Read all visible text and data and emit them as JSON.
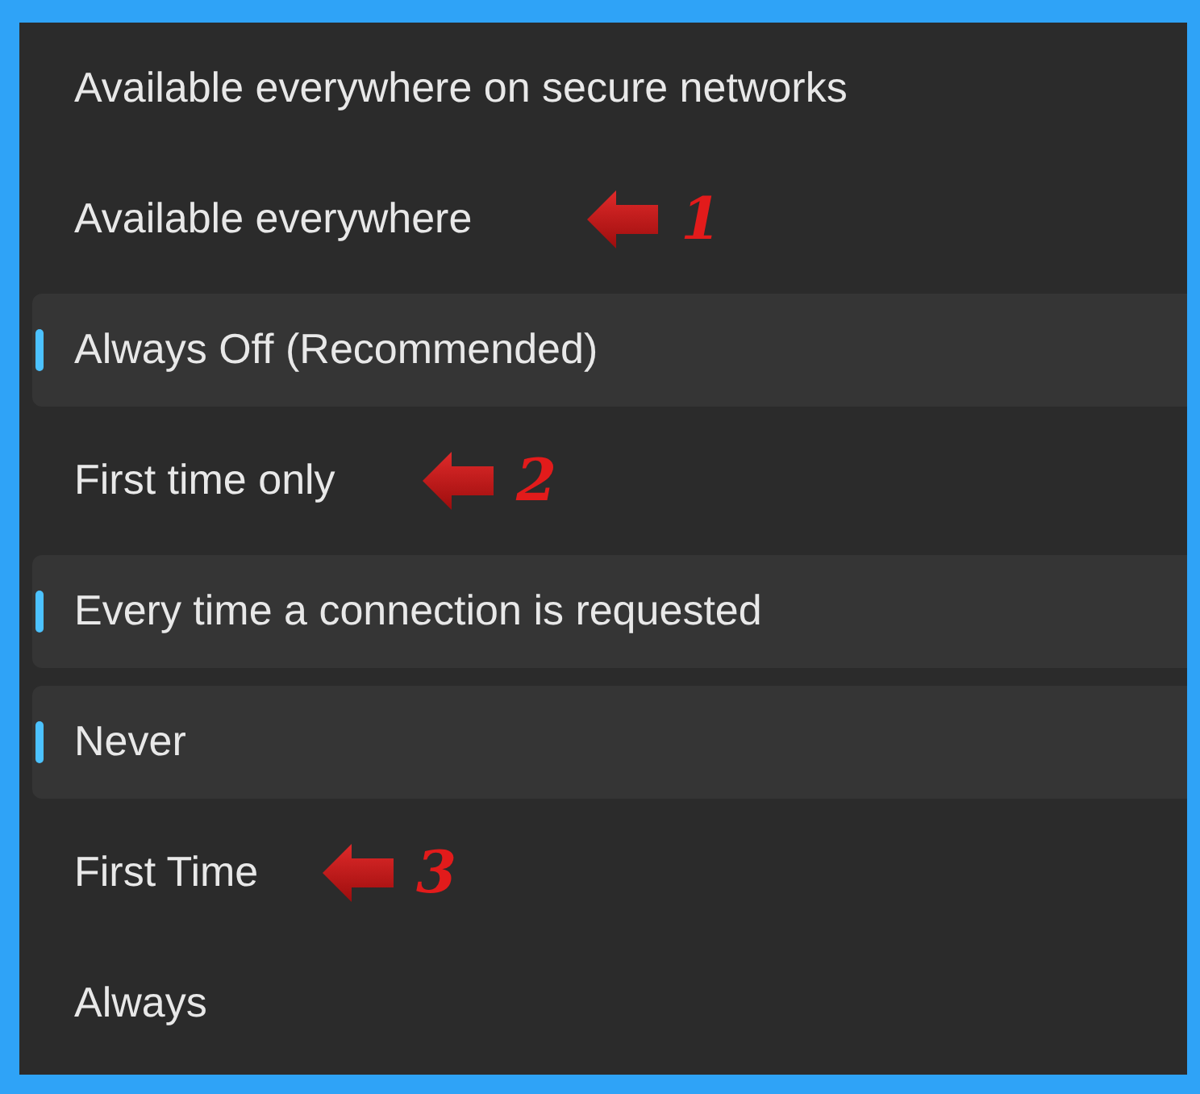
{
  "menu_items": [
    {
      "label": "Available everywhere on secure networks",
      "selected": false
    },
    {
      "label": "Available everywhere",
      "selected": false,
      "annotation": "1"
    },
    {
      "label": "Always Off (Recommended)",
      "selected": true
    },
    {
      "label": "First time only",
      "selected": false,
      "annotation": "2"
    },
    {
      "label": "Every time a connection is requested",
      "selected": true
    },
    {
      "label": "Never",
      "selected": true
    },
    {
      "label": "First Time",
      "selected": false,
      "annotation": "3"
    },
    {
      "label": "Always",
      "selected": false
    }
  ]
}
